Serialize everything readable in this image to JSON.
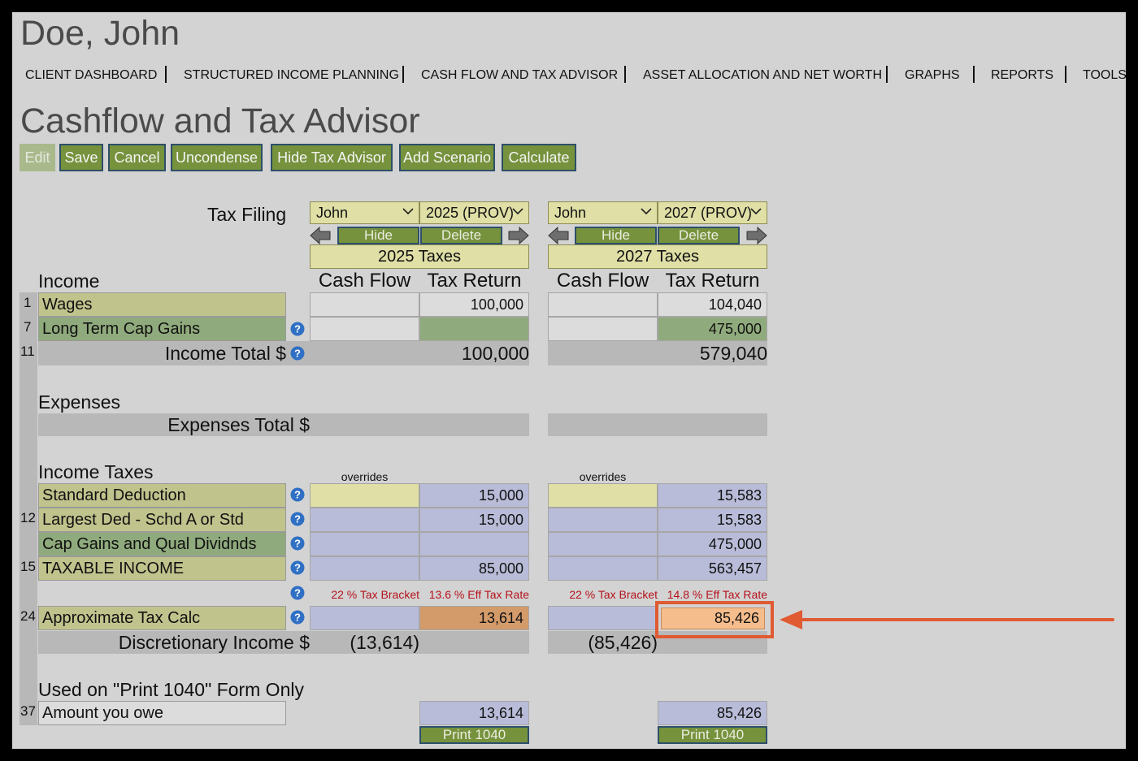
{
  "client_name": "Doe, John",
  "nav": [
    "CLIENT DASHBOARD",
    "STRUCTURED INCOME PLANNING",
    "CASH FLOW AND TAX ADVISOR",
    "ASSET ALLOCATION AND NET WORTH",
    "GRAPHS",
    "REPORTS",
    "TOOLS"
  ],
  "page_title": "Cashflow and Tax Advisor",
  "toolbar": {
    "edit": "Edit",
    "save": "Save",
    "cancel": "Cancel",
    "uncondense": "Uncondense",
    "hide_tax_advisor": "Hide Tax Advisor",
    "add_scenario": "Add Scenario",
    "calculate": "Calculate"
  },
  "labels": {
    "tax_filing": "Tax Filing",
    "income": "Income",
    "cash_flow": "Cash Flow",
    "tax_return": "Tax Return",
    "income_total": "Income Total $",
    "expenses": "Expenses",
    "expenses_total": "Expenses Total $",
    "income_taxes": "Income Taxes",
    "overrides": "overrides",
    "discretionary_income": "Discretionary Income $",
    "print_1040_only": "Used on \"Print 1040\" Form Only"
  },
  "rows": {
    "wages": {
      "num": "1",
      "label": "Wages"
    },
    "ltcg": {
      "num": "7",
      "label": "Long Term Cap Gains"
    },
    "income_total_num": "11",
    "std_ded": {
      "label": "Standard Deduction"
    },
    "largest_ded": {
      "num": "12",
      "label": "Largest Ded - Schd A or Std"
    },
    "cap_gains_qual": {
      "label": "Cap Gains and Qual Dividnds"
    },
    "taxable_income": {
      "num": "15",
      "label": "TAXABLE INCOME"
    },
    "approx_tax": {
      "num": "24",
      "label": "Approximate Tax Calc"
    },
    "amount_owe": {
      "num": "37",
      "label": "Amount you owe"
    }
  },
  "scenarios": [
    {
      "person": "John",
      "year_select": "2025 (PROV)",
      "hide": "Hide",
      "delete": "Delete",
      "header": "2025 Taxes",
      "wages_tr": "100,000",
      "ltcg_tr": "",
      "income_total": "100,000",
      "std_ded": "15,000",
      "largest_ded": "15,000",
      "cap_gains_qual": "",
      "taxable_income": "85,000",
      "tax_bracket": "22 % Tax Bracket",
      "eff_rate": "13.6 % Eff Tax Rate",
      "approx_tax": "13,614",
      "discretionary": "(13,614)",
      "amount_owe": "13,614",
      "print": "Print 1040"
    },
    {
      "person": "John",
      "year_select": "2027 (PROV)",
      "hide": "Hide",
      "delete": "Delete",
      "header": "2027 Taxes",
      "wages_tr": "104,040",
      "ltcg_tr": "475,000",
      "income_total": "579,040",
      "std_ded": "15,583",
      "largest_ded": "15,583",
      "cap_gains_qual": "475,000",
      "taxable_income": "563,457",
      "tax_bracket": "22 % Tax Bracket",
      "eff_rate": "14.8 % Eff Tax Rate",
      "approx_tax": "85,426",
      "discretionary": "(85,426)",
      "amount_owe": "85,426",
      "print": "Print 1040"
    }
  ],
  "colors": {
    "olive": "#c1c38d",
    "green": "#8faa7c",
    "lavender": "#b8bcd8",
    "tax_orange": "#d39a6a",
    "tax_highlight": "#f6bd8c",
    "annotation_red": "#e05a32"
  }
}
